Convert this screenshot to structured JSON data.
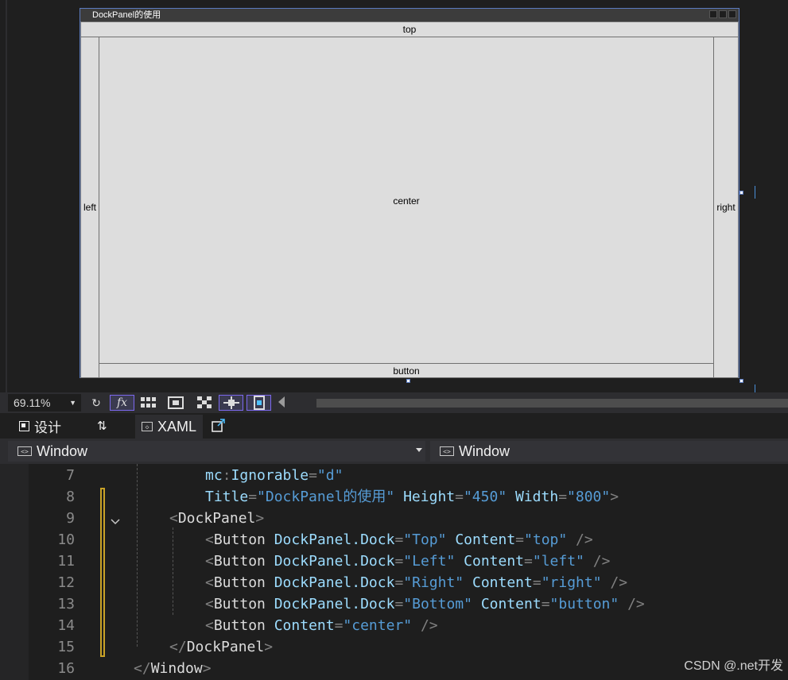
{
  "preview_window": {
    "title": "DockPanel的使用",
    "buttons": {
      "top": "top",
      "left": "left",
      "right": "right",
      "bottom": "button",
      "center": "center"
    }
  },
  "zoom": {
    "value": "69.11%"
  },
  "toolbar": {
    "fx_label": "fx"
  },
  "tabs": {
    "design": "设计",
    "swap_icon": "⇅",
    "xaml": "XAML"
  },
  "nav": {
    "left": "Window",
    "right": "Window"
  },
  "code_lines": [
    {
      "num": "7",
      "indent": 258,
      "tokens": [
        [
          "attr",
          "mc"
        ],
        [
          "punc",
          ":"
        ],
        [
          "attr",
          "Ignorable"
        ],
        [
          "punc",
          "="
        ],
        [
          "str",
          "\"d\""
        ]
      ]
    },
    {
      "num": "8",
      "indent": 258,
      "tokens": [
        [
          "attr",
          "Title"
        ],
        [
          "punc",
          "="
        ],
        [
          "str",
          "\"DockPanel的使用\""
        ],
        [
          "punc",
          " "
        ],
        [
          "attr",
          "Height"
        ],
        [
          "punc",
          "="
        ],
        [
          "str",
          "\"450\""
        ],
        [
          "punc",
          " "
        ],
        [
          "attr",
          "Width"
        ],
        [
          "punc",
          "="
        ],
        [
          "str",
          "\"800\""
        ],
        [
          "punc",
          ">"
        ]
      ]
    },
    {
      "num": "9",
      "indent": 213,
      "tokens": [
        [
          "punc",
          "<"
        ],
        [
          "name",
          "DockPanel"
        ],
        [
          "punc",
          ">"
        ]
      ]
    },
    {
      "num": "10",
      "indent": 258,
      "tokens": [
        [
          "punc",
          "<"
        ],
        [
          "name",
          "Button"
        ],
        [
          "punc",
          " "
        ],
        [
          "attr",
          "DockPanel.Dock"
        ],
        [
          "punc",
          "="
        ],
        [
          "str",
          "\"Top\""
        ],
        [
          "punc",
          " "
        ],
        [
          "attr",
          "Content"
        ],
        [
          "punc",
          "="
        ],
        [
          "str",
          "\"top\""
        ],
        [
          "punc",
          " />"
        ]
      ]
    },
    {
      "num": "11",
      "indent": 258,
      "tokens": [
        [
          "punc",
          "<"
        ],
        [
          "name",
          "Button"
        ],
        [
          "punc",
          " "
        ],
        [
          "attr",
          "DockPanel.Dock"
        ],
        [
          "punc",
          "="
        ],
        [
          "str",
          "\"Left\""
        ],
        [
          "punc",
          " "
        ],
        [
          "attr",
          "Content"
        ],
        [
          "punc",
          "="
        ],
        [
          "str",
          "\"left\""
        ],
        [
          "punc",
          " />"
        ]
      ]
    },
    {
      "num": "12",
      "indent": 258,
      "tokens": [
        [
          "punc",
          "<"
        ],
        [
          "name",
          "Button"
        ],
        [
          "punc",
          " "
        ],
        [
          "attr",
          "DockPanel.Dock"
        ],
        [
          "punc",
          "="
        ],
        [
          "str",
          "\"Right\""
        ],
        [
          "punc",
          " "
        ],
        [
          "attr",
          "Content"
        ],
        [
          "punc",
          "="
        ],
        [
          "str",
          "\"right\""
        ],
        [
          "punc",
          " />"
        ]
      ]
    },
    {
      "num": "13",
      "indent": 258,
      "tokens": [
        [
          "punc",
          "<"
        ],
        [
          "name",
          "Button"
        ],
        [
          "punc",
          " "
        ],
        [
          "attr",
          "DockPanel.Dock"
        ],
        [
          "punc",
          "="
        ],
        [
          "str",
          "\"Bottom\""
        ],
        [
          "punc",
          " "
        ],
        [
          "attr",
          "Content"
        ],
        [
          "punc",
          "="
        ],
        [
          "str",
          "\"button\""
        ],
        [
          "punc",
          " />"
        ]
      ]
    },
    {
      "num": "14",
      "indent": 258,
      "tokens": [
        [
          "punc",
          "<"
        ],
        [
          "name",
          "Button"
        ],
        [
          "punc",
          " "
        ],
        [
          "attr",
          "Content"
        ],
        [
          "punc",
          "="
        ],
        [
          "str",
          "\"center\""
        ],
        [
          "punc",
          " />"
        ]
      ]
    },
    {
      "num": "15",
      "indent": 213,
      "tokens": [
        [
          "punc",
          "</"
        ],
        [
          "name",
          "DockPanel"
        ],
        [
          "punc",
          ">"
        ]
      ]
    },
    {
      "num": "16",
      "indent": 168,
      "tokens": [
        [
          "punc",
          "</"
        ],
        [
          "name",
          "Window"
        ],
        [
          "punc",
          ">"
        ]
      ]
    }
  ],
  "watermark": "CSDN @.net开发",
  "icons": [
    "refresh-icon",
    "fx-icon",
    "grid-icon",
    "snap-grid-icon",
    "checker-icon",
    "snap-lines-icon",
    "device-icon",
    "design-tab-icon",
    "swap-pane-icon",
    "xaml-tab-icon",
    "popout-icon",
    "code-element-icon",
    "fold-chevron-icon"
  ]
}
